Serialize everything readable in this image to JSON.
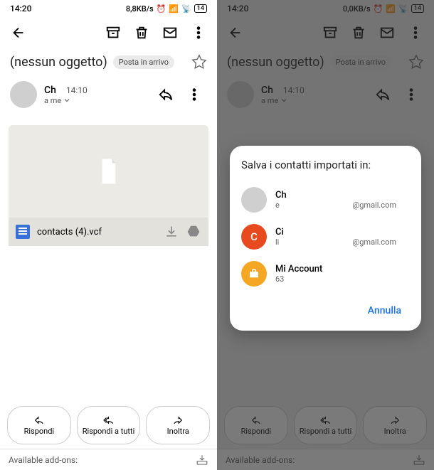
{
  "status": {
    "time": "14:20",
    "speed_left": "8,8KB/s",
    "speed_right": "0,0KB/s",
    "battery": "14"
  },
  "subject": {
    "text": "(nessun oggetto)",
    "chip": "Posta in arrivo"
  },
  "sender": {
    "name": "Ch",
    "time": "14:10",
    "recipient": "a me"
  },
  "attachment": {
    "filename": "contacts (4).vcf"
  },
  "actions": {
    "reply": "Rispondi",
    "replyAll": "Rispondi a tutti",
    "forward": "Inoltra"
  },
  "addons": {
    "label": "Available add-ons:"
  },
  "dialog": {
    "title": "Salva i contatti importati in:",
    "accounts": [
      {
        "name": "Ch",
        "sub": "e",
        "domain": "@gmail.com"
      },
      {
        "name": "Ci",
        "sub": "li",
        "domain": "@gmail.com"
      },
      {
        "name": "Mi Account",
        "sub": "63",
        "domain": ""
      }
    ],
    "cancel": "Annulla"
  }
}
